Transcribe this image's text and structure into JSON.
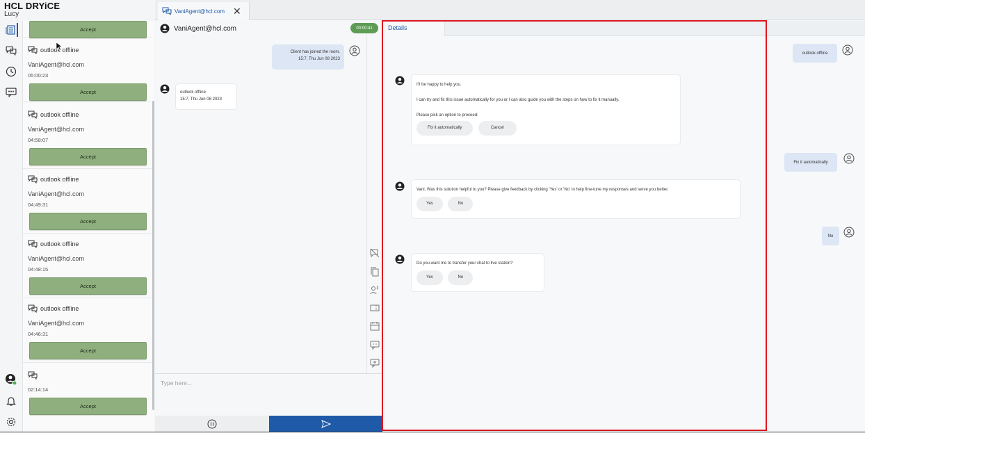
{
  "brand": {
    "title": "HCL DRYiCE",
    "user": "Lucy"
  },
  "tab": {
    "label": "VaniAgent@hcl.com",
    "close": "✕"
  },
  "queue": [
    {
      "title": "",
      "email": "",
      "time": "",
      "accept": "Accept"
    },
    {
      "title": "outlook offline",
      "email": "VaniAgent@hcl.com",
      "time": "05:00:23",
      "accept": "Accept"
    },
    {
      "title": "outlook offline",
      "email": "VaniAgent@hcl.com",
      "time": "04:58:07",
      "accept": "Accept"
    },
    {
      "title": "outlook offline",
      "email": "VaniAgent@hcl.com",
      "time": "04:49:31",
      "accept": "Accept"
    },
    {
      "title": "outlook offline",
      "email": "VaniAgent@hcl.com",
      "time": "04:48:15",
      "accept": "Accept"
    },
    {
      "title": "outlook offline",
      "email": "VaniAgent@hcl.com",
      "time": "04:46:31",
      "accept": "Accept"
    },
    {
      "title": "",
      "email": "",
      "time": "02:14:14",
      "accept": "Accept"
    }
  ],
  "chat": {
    "agent": "VaniAgent@hcl.com",
    "timer": "00:00:41",
    "system_msg": "Client has joined the room.",
    "system_time": "15:7, Thu Jun 08 2023",
    "client_msg": "outlook offline",
    "client_time": "15:7, Thu Jun 08 2023",
    "placeholder": "Type here..."
  },
  "details": {
    "tab": "Details",
    "card1": {
      "line1": "I'll be happy to help you.",
      "line2": "I can try and fix this issue automatically for you or I can also guide you with the steps on how to fix it manually.",
      "line3": "Please pick an option to proceed:",
      "btn1": "Fix it automatically",
      "btn2": "Cancel"
    },
    "card2": {
      "line1": "Vani, Was this solution helpful to you? Please give feedback by clicking 'Yes' or 'No' to help fine-tune my responses and serve you better.",
      "btn1": "Yes",
      "btn2": "No"
    },
    "card3": {
      "line1": "Do you want me to transfer your chat to live station?",
      "btn1": "Yes",
      "btn2": "No"
    },
    "user1": "outlook offline",
    "user2": "Fix it automatically",
    "user3": "No"
  },
  "colors": {
    "accent": "#1e5aa8",
    "accept": "#8fb07e",
    "timer": "#5e9c55",
    "highlight": "#e0161f"
  }
}
